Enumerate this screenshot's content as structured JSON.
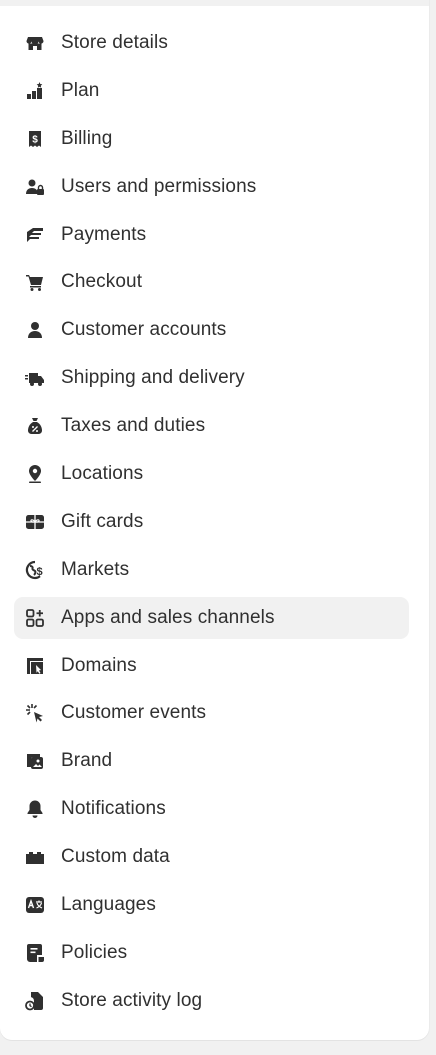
{
  "nav": {
    "items": [
      {
        "label": "Store details",
        "icon": "store-icon"
      },
      {
        "label": "Plan",
        "icon": "plan-icon"
      },
      {
        "label": "Billing",
        "icon": "billing-icon"
      },
      {
        "label": "Users and permissions",
        "icon": "users-icon"
      },
      {
        "label": "Payments",
        "icon": "payments-icon"
      },
      {
        "label": "Checkout",
        "icon": "cart-icon"
      },
      {
        "label": "Customer accounts",
        "icon": "person-icon"
      },
      {
        "label": "Shipping and delivery",
        "icon": "truck-icon"
      },
      {
        "label": "Taxes and duties",
        "icon": "tax-bag-icon"
      },
      {
        "label": "Locations",
        "icon": "location-pin-icon"
      },
      {
        "label": "Gift cards",
        "icon": "gift-card-icon"
      },
      {
        "label": "Markets",
        "icon": "globe-icon"
      },
      {
        "label": "Apps and sales channels",
        "icon": "apps-icon",
        "active": true
      },
      {
        "label": "Domains",
        "icon": "domains-icon"
      },
      {
        "label": "Customer events",
        "icon": "cursor-click-icon"
      },
      {
        "label": "Brand",
        "icon": "brand-icon"
      },
      {
        "label": "Notifications",
        "icon": "bell-icon"
      },
      {
        "label": "Custom data",
        "icon": "custom-data-icon"
      },
      {
        "label": "Languages",
        "icon": "language-icon"
      },
      {
        "label": "Policies",
        "icon": "policies-icon"
      },
      {
        "label": "Store activity log",
        "icon": "activity-log-icon"
      }
    ]
  },
  "colors": {
    "text": "#303030",
    "icon": "#303030",
    "active_bg": "#f1f1f1",
    "page_bg": "#f1f1f1",
    "panel_bg": "#ffffff"
  }
}
